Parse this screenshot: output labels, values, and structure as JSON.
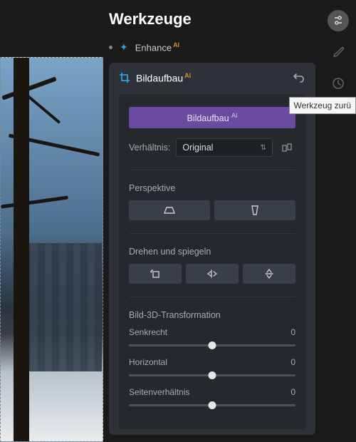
{
  "header": {
    "title": "Werkzeuge"
  },
  "enhance": {
    "label": "Enhance",
    "ai": "AI"
  },
  "panel": {
    "title": "Bildaufbau",
    "ai": "AI",
    "bigButton": "Bildaufbau",
    "bigButtonAi": "AI",
    "ratioLabel": "Verhältnis:",
    "ratioValue": "Original"
  },
  "perspective": {
    "title": "Perspektive"
  },
  "rotate": {
    "title": "Drehen und spiegeln"
  },
  "transform3d": {
    "title": "Bild-3D-Transformation",
    "sliders": [
      {
        "label": "Senkrecht",
        "value": "0",
        "pos": 50
      },
      {
        "label": "Horizontal",
        "value": "0",
        "pos": 50
      },
      {
        "label": "Seitenverhältnis",
        "value": "0",
        "pos": 50
      }
    ]
  },
  "tooltip": "Werkzeug zurü",
  "icons": {
    "settings": "settings-icon",
    "brush": "brush-icon",
    "history": "history-icon"
  }
}
